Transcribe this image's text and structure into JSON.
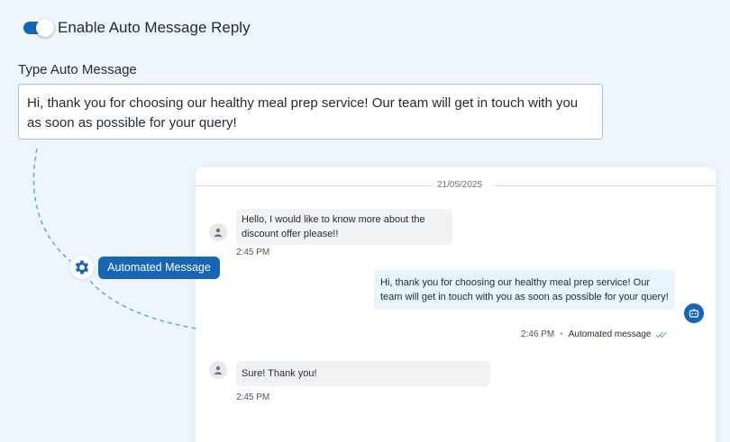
{
  "toggle": {
    "label": "Enable Auto Message Reply",
    "state": "on"
  },
  "auto_message": {
    "label": "Type Auto Message",
    "value": "Hi, thank you for choosing our healthy meal prep service! Our team will get in touch with you as soon as possible for your query!"
  },
  "badge": {
    "label": "Automated Message",
    "icon": "gear-icon"
  },
  "chat": {
    "date": "21/05/2025",
    "messages": [
      {
        "from": "user",
        "text": "Hello, I would like to know more about the discount offer please!!",
        "time": "2:45 PM"
      },
      {
        "from": "bot",
        "text": "Hi, thank you for choosing our healthy meal prep service! Our team will get in touch with you as soon as possible for your query!",
        "time": "2:46 PM",
        "tag": "Automated message"
      },
      {
        "from": "user",
        "text": "Sure! Thank you!",
        "time": "2:45 PM"
      }
    ]
  },
  "colors": {
    "accent": "#1565b8",
    "dash": "#5aaed8",
    "bot_bubble": "#eaf4fe",
    "user_bubble": "#f1f2f4"
  }
}
